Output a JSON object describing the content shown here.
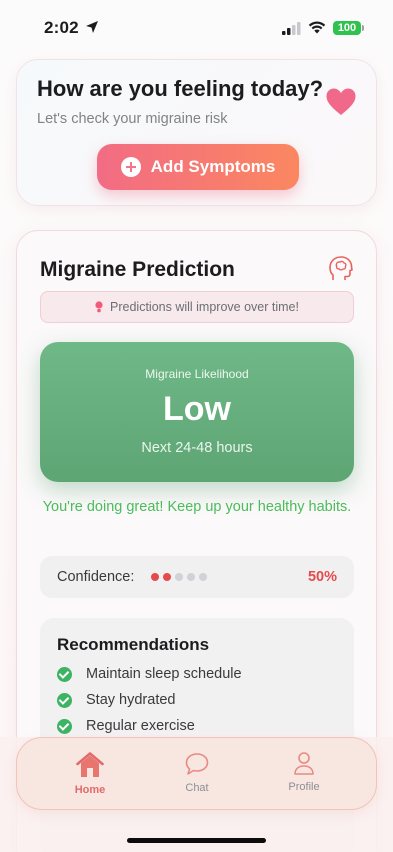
{
  "status_bar": {
    "time": "2:02",
    "battery": "100",
    "icons": [
      "location-arrow-icon",
      "cellular-signal-icon",
      "wifi-icon",
      "battery-icon"
    ]
  },
  "feeling_card": {
    "title": "How are you feeling today?",
    "subtitle": "Let's check your migraine risk",
    "add_button_label": "Add Symptoms",
    "heart_color": "#f0698a"
  },
  "prediction_card": {
    "title": "Migraine Prediction",
    "banner_text": "Predictions will improve over time!",
    "likelihood": {
      "label": "Migraine Likelihood",
      "value": "Low",
      "window": "Next 24-48 hours",
      "color": "#66ae7d"
    },
    "encouragement": "You're doing great! Keep up your healthy habits.",
    "confidence": {
      "label": "Confidence:",
      "value": "50%",
      "filled_dots": 2,
      "total_dots": 5,
      "active_color": "#e54b4b",
      "inactive_color": "#d2d2d6"
    },
    "recommendations": {
      "title": "Recommendations",
      "items": [
        "Maintain sleep schedule",
        "Stay hydrated",
        "Regular exercise"
      ]
    }
  },
  "tab_bar": {
    "tabs": [
      {
        "label": "Home",
        "icon": "home-icon",
        "active": true
      },
      {
        "label": "Chat",
        "icon": "chat-bubble-icon",
        "active": false
      },
      {
        "label": "Profile",
        "icon": "person-icon",
        "active": false
      }
    ],
    "accent": "#e26a6a"
  }
}
